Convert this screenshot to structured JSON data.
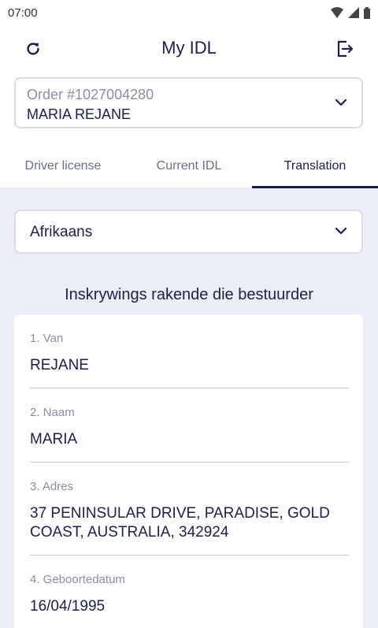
{
  "status_bar": {
    "time": "07:00"
  },
  "app_bar": {
    "title": "My IDL"
  },
  "order": {
    "label": "Order #1027004280",
    "name": "MARIA REJANE"
  },
  "tabs": [
    {
      "label": "Driver license"
    },
    {
      "label": "Current IDL"
    },
    {
      "label": "Translation"
    }
  ],
  "language": {
    "selected": "Afrikaans"
  },
  "section": {
    "title": "Inskrywings rakende die bestuurder"
  },
  "fields": [
    {
      "label": "1. Van",
      "value": "REJANE"
    },
    {
      "label": "2. Naam",
      "value": "MARIA"
    },
    {
      "label": "3. Adres",
      "value": "37 PENINSULAR DRIVE, PARADISE, GOLD COAST, AUSTRALIA, 342924"
    },
    {
      "label": "4. Geboortedatum",
      "value": "16/04/1995"
    }
  ],
  "colors": {
    "primary": "#1b1f4a",
    "background": "#eceef5",
    "muted": "#8a8fa3"
  }
}
